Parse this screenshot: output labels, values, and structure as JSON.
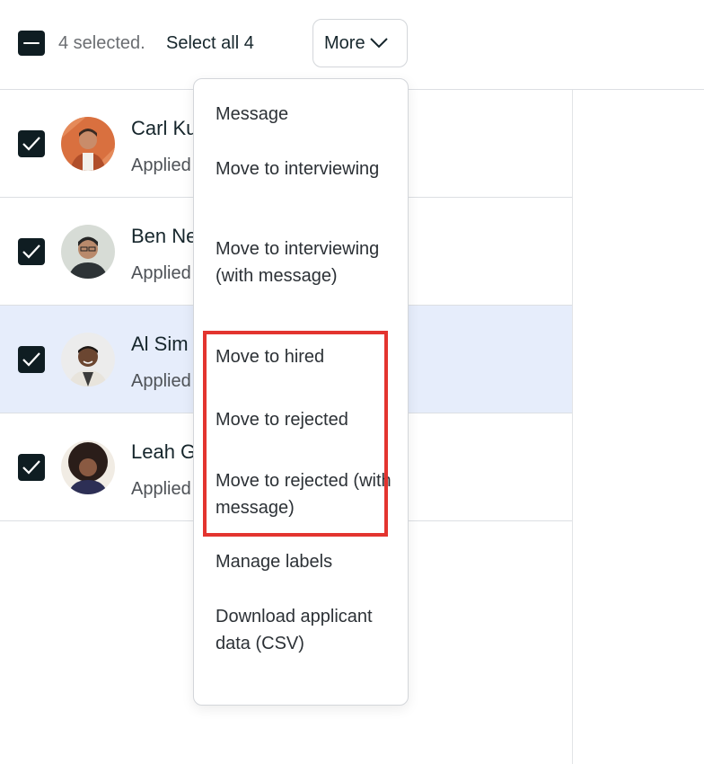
{
  "toolbar": {
    "selected_text": "4 selected.",
    "select_all_label": "Select all 4",
    "more_label": "More"
  },
  "rows": [
    {
      "name": "Carl Ku",
      "sub": "Applied",
      "selected": true
    },
    {
      "name": "Ben Ne",
      "sub": "Applied",
      "selected": true
    },
    {
      "name": "Al Sim",
      "sub": "Applied",
      "selected": true
    },
    {
      "name": "Leah G",
      "sub": "Applied",
      "selected": true
    }
  ],
  "menu": {
    "items": [
      "Message",
      "Move to interviewing",
      "Move to interviewing (with message)",
      "Move to hired",
      "Move to rejected",
      "Move to rejected (with message)",
      "Manage labels",
      "Download applicant data (CSV)"
    ]
  },
  "colors": {
    "checkbox": "#0f1d22",
    "row_highlight": "#e6edfb",
    "annotation": "#e3342f"
  }
}
